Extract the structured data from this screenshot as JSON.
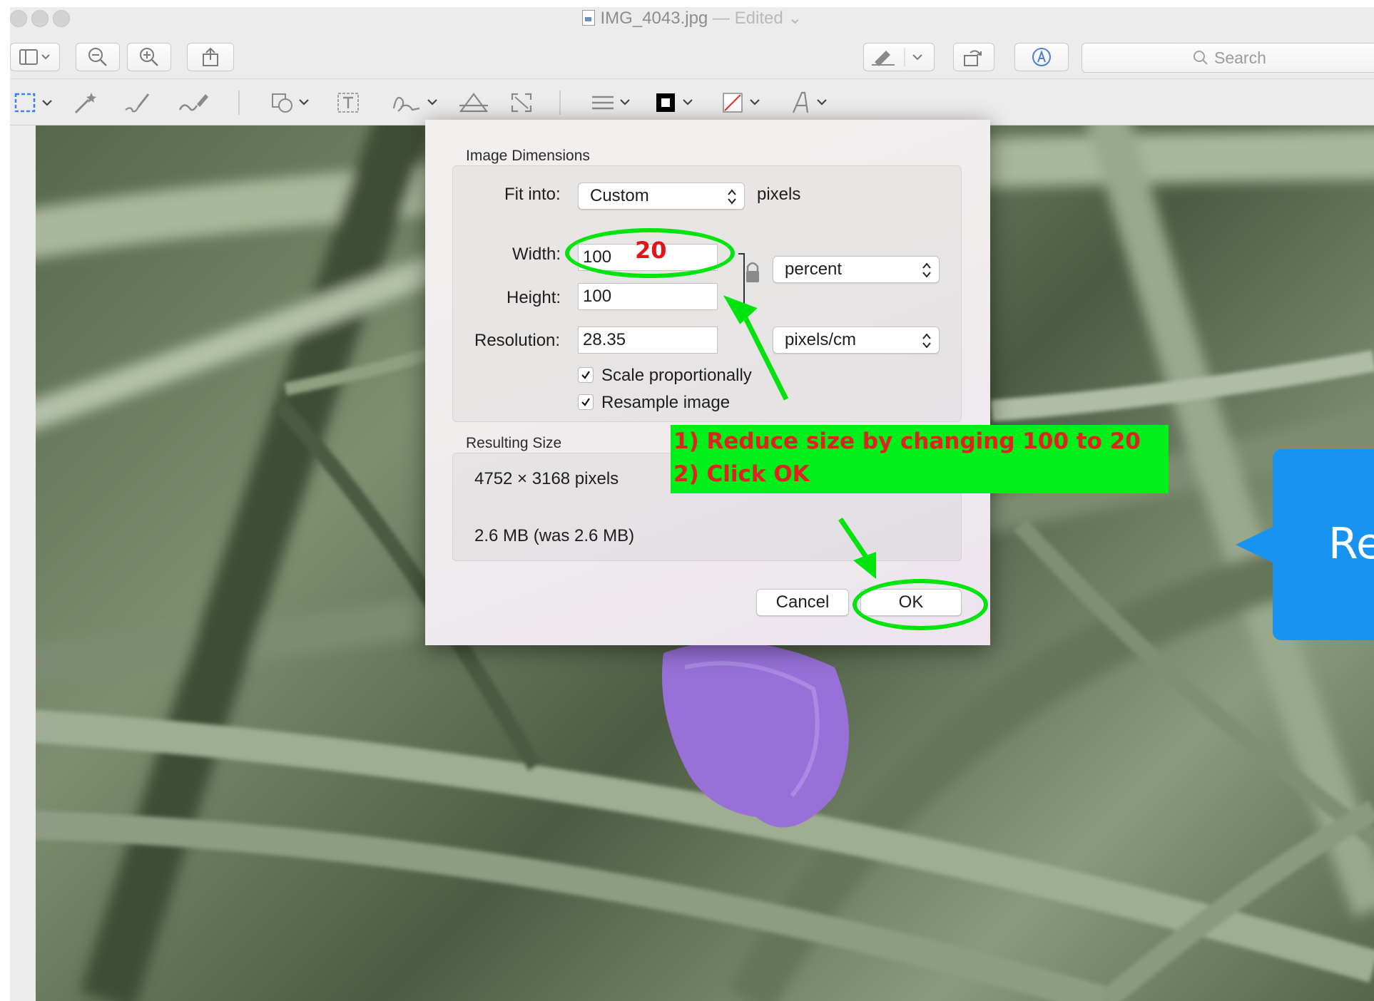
{
  "window": {
    "title": "IMG_4043.jpg",
    "title_separator": "—",
    "status": "Edited",
    "search_placeholder": "Search"
  },
  "toolbar": {
    "left_buttons": [
      "sidebar-icon",
      "zoom-out-icon",
      "zoom-in-icon",
      "share-icon"
    ],
    "right_buttons": [
      "markup-pen-icon",
      "rotate-icon",
      "annotate-icon"
    ]
  },
  "markup_tools": [
    "rect-selection-icon",
    "instant-alpha-icon",
    "sketch-icon",
    "draw-icon",
    "shapes-icon",
    "text-icon",
    "sign-icon",
    "adjust-color-icon",
    "adjust-size-icon",
    "shape-style-icon",
    "border-color-icon",
    "fill-color-icon",
    "text-style-icon"
  ],
  "dialog": {
    "image_dimensions_title": "Image Dimensions",
    "fit_into_label": "Fit into:",
    "fit_into_value": "Custom",
    "fit_into_unit": "pixels",
    "width_label": "Width:",
    "width_value": "100",
    "height_label": "Height:",
    "height_value": "100",
    "resolution_label": "Resolution:",
    "resolution_value": "28.35",
    "size_unit": "percent",
    "resolution_unit": "pixels/cm",
    "scale_proportionally_label": "Scale proportionally",
    "scale_proportionally_checked": true,
    "resample_label": "Resample image",
    "resample_checked": true,
    "resulting_size_title": "Resulting Size",
    "resulting_pixels": "4752 × 3168 pixels",
    "resulting_filesize": "2.6 MB (was 2.6 MB)",
    "cancel_label": "Cancel",
    "ok_label": "OK"
  },
  "annotations": {
    "new_width_text": "20",
    "instruction_line1": "1) Reduce size  by changing 100 to 20",
    "instruction_line2": "2) Click OK",
    "callout_text": "Re",
    "highlight_color": "#00e30c",
    "text_color": "#e32020",
    "callout_color": "#1893f0"
  },
  "colors": {
    "accent": "#1893f0",
    "window_bg": "#ececec"
  }
}
